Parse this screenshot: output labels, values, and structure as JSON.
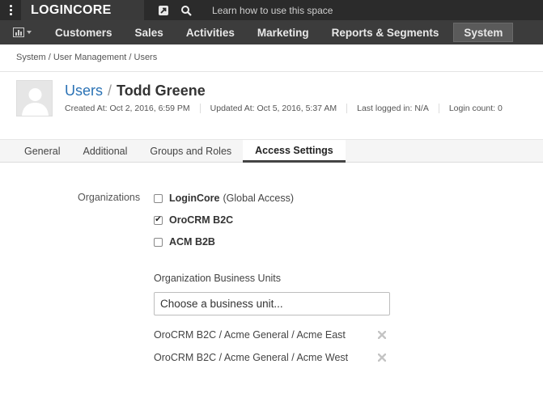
{
  "topbar": {
    "logo": "LOGINCORE",
    "search_hint": "Learn how to use this space"
  },
  "nav": {
    "items": [
      "Customers",
      "Sales",
      "Activities",
      "Marketing",
      "Reports & Segments",
      "System"
    ],
    "active": "System"
  },
  "breadcrumb": "System / User Management / Users",
  "header": {
    "entity": "Users",
    "separator": "/",
    "name": "Todd Greene",
    "meta": [
      "Created At: Oct 2, 2016, 6:59 PM",
      "Updated At: Oct 5, 2016, 5:37 AM",
      "Last logged in: N/A",
      "Login count: 0"
    ]
  },
  "tabs": [
    "General",
    "Additional",
    "Groups and Roles",
    "Access Settings"
  ],
  "active_tab": "Access Settings",
  "form": {
    "organizations_label": "Organizations",
    "organizations": [
      {
        "name": "LoginCore",
        "suffix": "(Global Access)",
        "checked": false
      },
      {
        "name": "OroCRM B2C",
        "suffix": "",
        "checked": true
      },
      {
        "name": "ACM B2B",
        "suffix": "",
        "checked": false
      }
    ],
    "bu_label": "Organization Business Units",
    "bu_placeholder": "Choose a business unit...",
    "selected_units": [
      "OroCRM B2C / Acme General / Acme East",
      "OroCRM B2C / Acme General / Acme West"
    ]
  },
  "colors": {
    "topbar_bg": "#2b2b2b",
    "nav_bg": "#3c3c3c",
    "link": "#2a72b5"
  },
  "icons": {
    "menu": "kebab-menu-icon",
    "pin": "pin-icon",
    "search": "search-icon",
    "dashboard": "dashboard-icon",
    "remove": "remove-x-icon",
    "avatar": "avatar-placeholder-icon"
  }
}
